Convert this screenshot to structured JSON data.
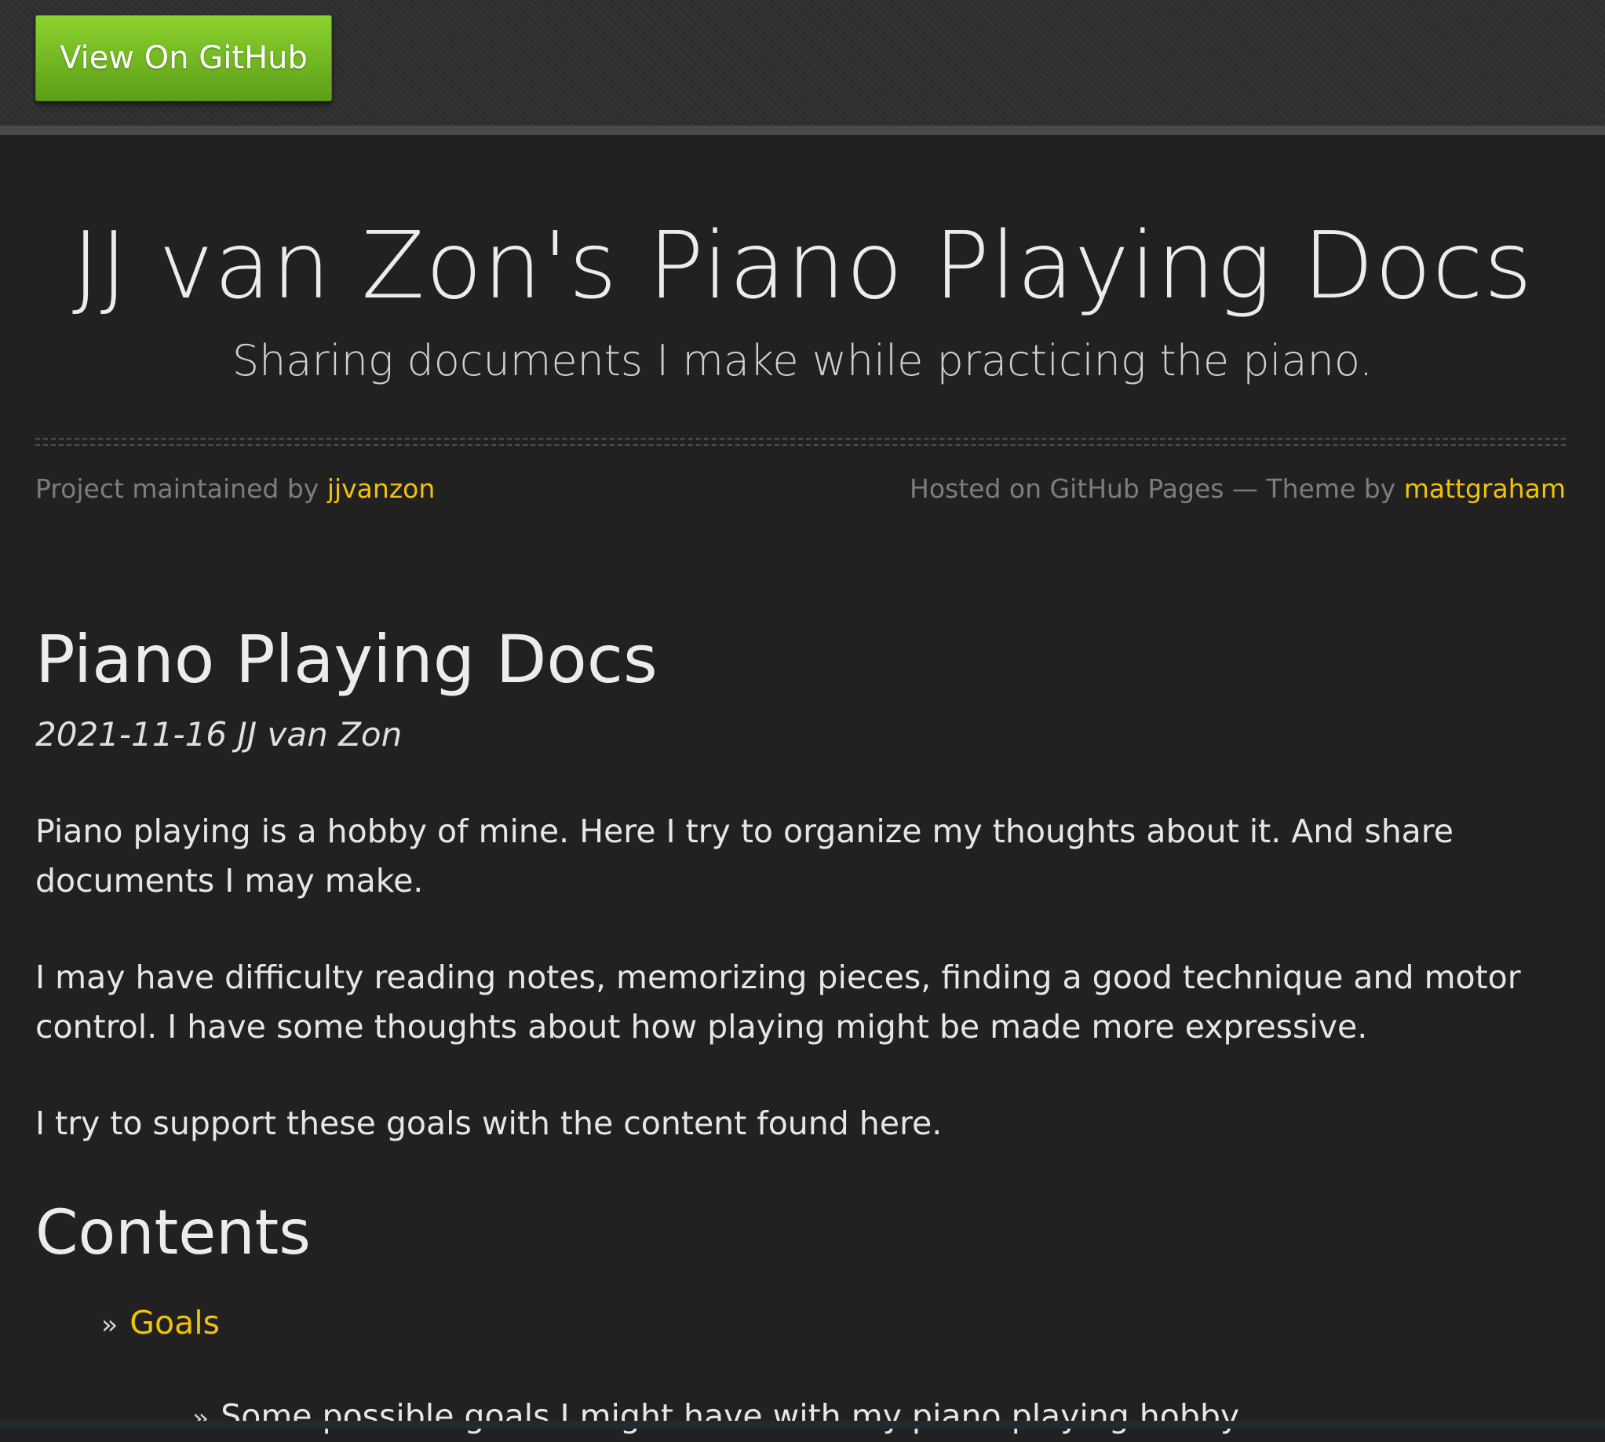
{
  "topbar": {
    "github_button_label": "View On GitHub"
  },
  "header": {
    "title": "JJ van Zon's Piano Playing Docs",
    "subtitle": "Sharing documents I make while practicing the piano.",
    "maintained_prefix": "Project maintained by",
    "maintainer": "jjvanzon",
    "hosted_prefix": "Hosted on GitHub Pages — Theme by",
    "theme_author": "mattgraham"
  },
  "main": {
    "title": "Piano Playing Docs",
    "meta": "2021-11-16 JJ van Zon",
    "paragraphs": [
      "Piano playing is a hobby of mine. Here I try to organize my thoughts about it. And share documents I may make.",
      "I may have difficulty reading notes, memorizing pieces, finding a good technique and motor control. I have some thoughts about how playing might be made more expressive.",
      "I try to support these goals with the content found here."
    ],
    "contents_heading": "Contents",
    "toc": [
      {
        "label": "Goals"
      }
    ],
    "toc_sub": [
      {
        "label": "Some possible goals I might have with my piano playing hobby."
      }
    ]
  },
  "colors": {
    "background": "#212121",
    "link": "#f2c10a",
    "button_green": "#6fb51f"
  },
  "icons": {
    "bullet": "double-chevron-right-icon"
  }
}
